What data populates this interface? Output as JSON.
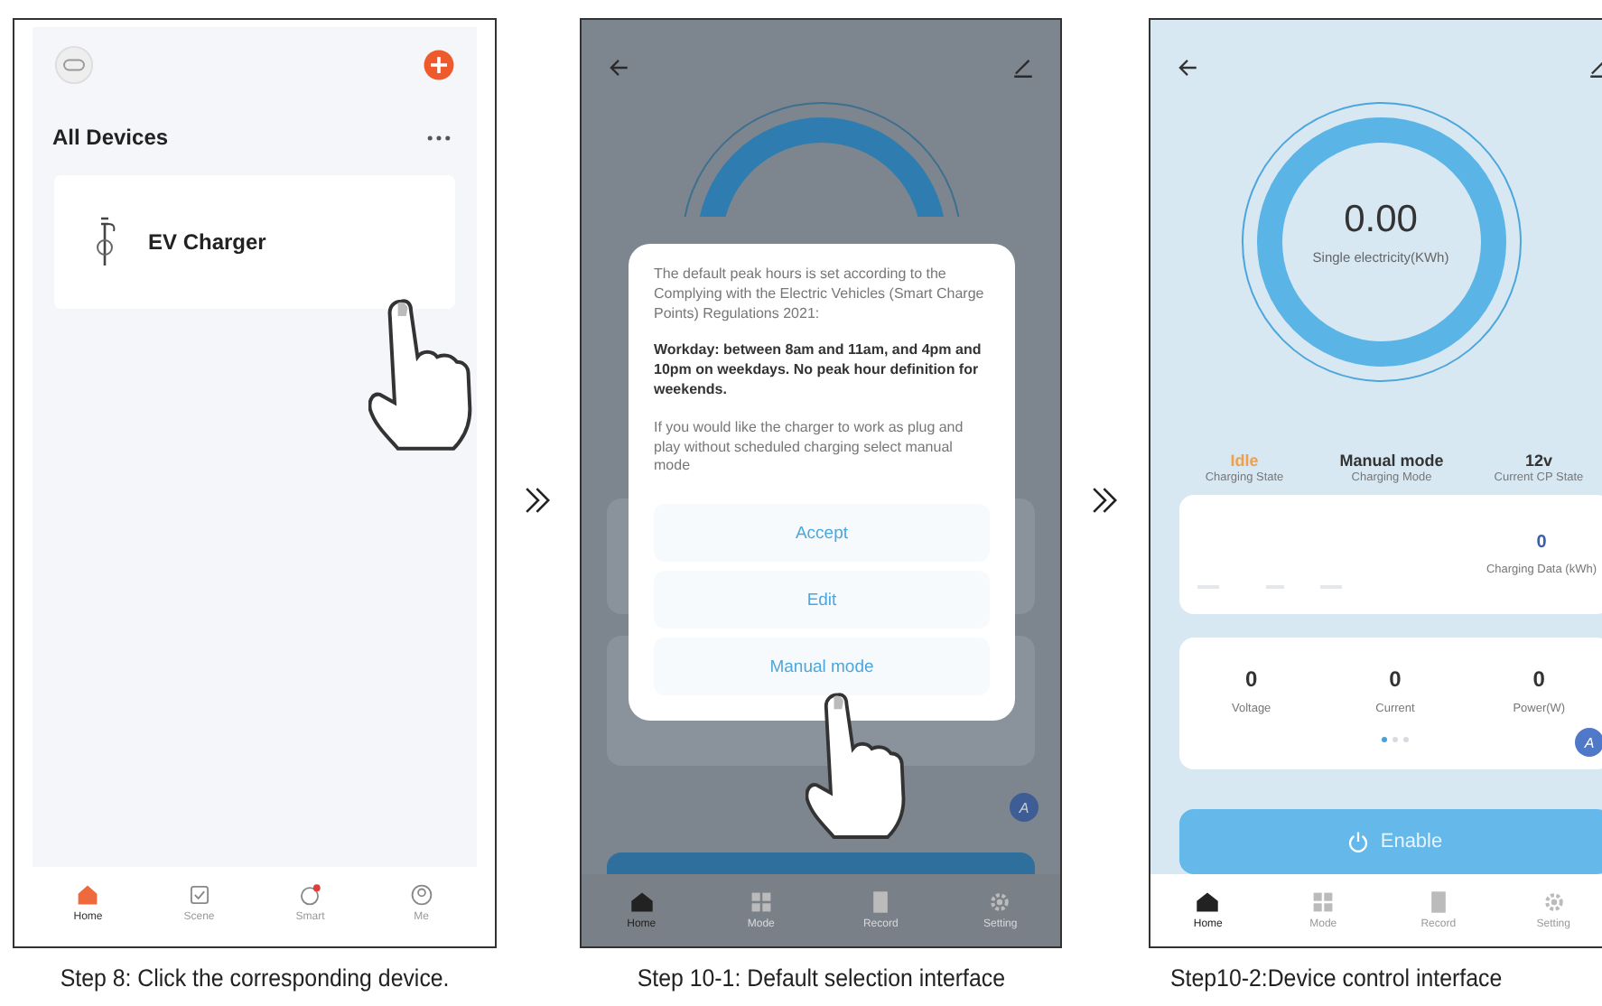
{
  "panels": [
    {
      "kind": "device_list",
      "caption": "Step 8: Click the corresponding device.",
      "title": "All Devices",
      "devices": [
        {
          "name": "EV Charger"
        }
      ],
      "nav": [
        {
          "label": "Home",
          "selected": true
        },
        {
          "label": "Scene",
          "selected": false
        },
        {
          "label": "Smart",
          "selected": false
        },
        {
          "label": "Me",
          "selected": false
        }
      ]
    },
    {
      "kind": "dialog",
      "caption": "Step 10-1: Default selection interface",
      "badge": "A",
      "paragraphs": [
        {
          "text": "The default peak hours is set according to the Complying with the Electric Vehicles (Smart Charge Points) Regulations 2021:",
          "bold": false
        },
        {
          "text": "Workday: between 8am and 11am, and 4pm and 10pm on weekdays. No peak hour definition for weekends.",
          "bold": true
        },
        {
          "text": "If you would like the charger to work as plug and play without scheduled charging select manual mode",
          "bold": false
        }
      ],
      "buttons": [
        "Accept",
        "Edit",
        "Manual mode"
      ],
      "nav": [
        {
          "label": "Home",
          "selected": true
        },
        {
          "label": "Mode",
          "selected": false
        },
        {
          "label": "Record",
          "selected": false
        },
        {
          "label": "Setting",
          "selected": false
        }
      ]
    },
    {
      "kind": "control",
      "caption": "Step10-2:Device control interface",
      "reading": "0.00",
      "reading_label": "Single electricity(KWh)",
      "badge": "A",
      "stats": [
        {
          "value": "Idle",
          "label": "Charging State",
          "color": "#f0a04b"
        },
        {
          "value": "Manual mode",
          "label": "Charging Mode",
          "color": "#333333"
        },
        {
          "value": "12v",
          "label": "Current CP State",
          "color": "#333333"
        }
      ],
      "chart_value": "0",
      "chart_label": "Charging Data (kWh)",
      "metrics": [
        {
          "value": "0",
          "label": "Voltage"
        },
        {
          "value": "0",
          "label": "Current"
        },
        {
          "value": "0",
          "label": "Power(W)"
        }
      ],
      "page_dots": [
        {
          "selected": true
        },
        {
          "selected": false
        },
        {
          "selected": false
        }
      ],
      "enable_button": "Enable",
      "nav": [
        {
          "label": "Home",
          "selected": true
        },
        {
          "label": "Mode",
          "selected": false
        },
        {
          "label": "Record",
          "selected": false
        },
        {
          "label": "Setting",
          "selected": false
        }
      ]
    }
  ]
}
